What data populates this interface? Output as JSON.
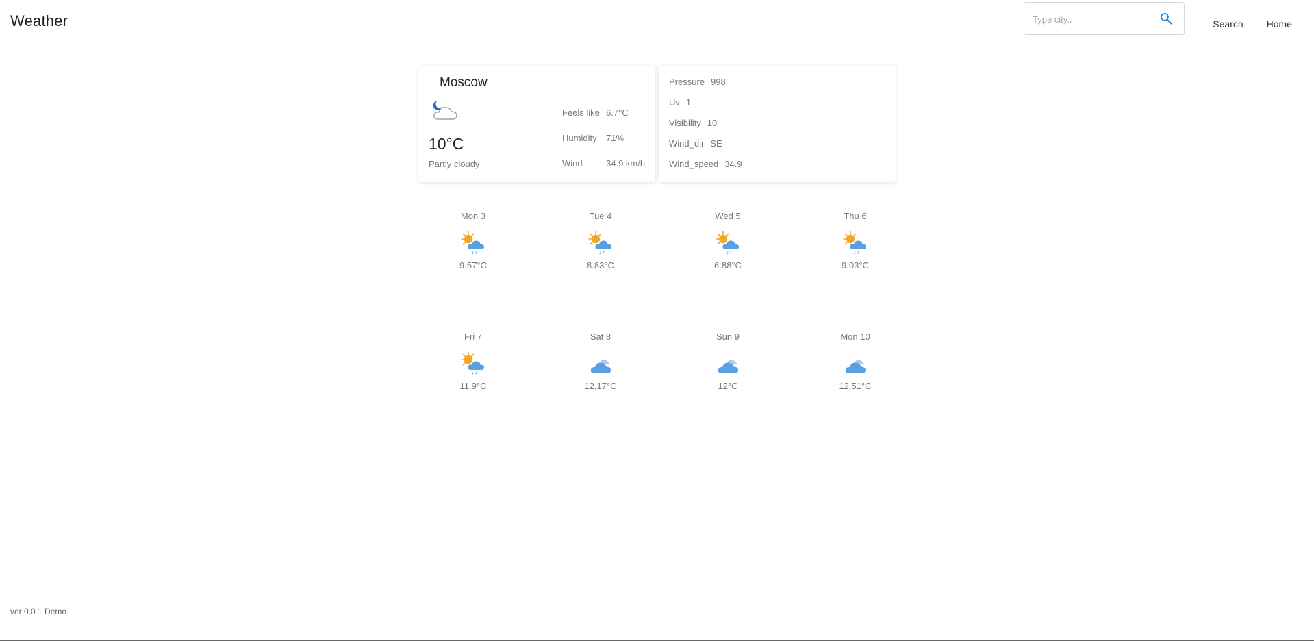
{
  "header": {
    "brand": "Weather",
    "search_placeholder": "Type city..",
    "search_value": "",
    "nav": [
      "Search",
      "Home"
    ]
  },
  "current": {
    "city": "Moscow",
    "icon": "moon-cloud-icon",
    "temp": "10°C",
    "condition": "Partly cloudy",
    "metrics": [
      {
        "label": "Feels like",
        "value": "6.7°C"
      },
      {
        "label": "Humidity",
        "value": "71%"
      },
      {
        "label": "Wind",
        "value": "34.9 km/h"
      }
    ]
  },
  "details": [
    {
      "label": "Pressure",
      "value": "998"
    },
    {
      "label": "Uv",
      "value": "1"
    },
    {
      "label": "Visibility",
      "value": "10"
    },
    {
      "label": "Wind_dir",
      "value": "SE"
    },
    {
      "label": "Wind_speed",
      "value": "34.9"
    }
  ],
  "forecast": [
    {
      "day": "Mon 3",
      "temp": "9.57°C",
      "icon": "sun-cloud-rain-icon"
    },
    {
      "day": "Tue 4",
      "temp": "8.83°C",
      "icon": "sun-cloud-rain-icon"
    },
    {
      "day": "Wed 5",
      "temp": "6.88°C",
      "icon": "sun-cloud-rain-icon"
    },
    {
      "day": "Thu 6",
      "temp": "9.03°C",
      "icon": "sun-cloud-rain-icon"
    },
    {
      "day": "Fri 7",
      "temp": "11.9°C",
      "icon": "sun-cloud-rain-icon"
    },
    {
      "day": "Sat 8",
      "temp": "12.17°C",
      "icon": "cloudy-icon"
    },
    {
      "day": "Sun 9",
      "temp": "12°C",
      "icon": "cloudy-icon"
    },
    {
      "day": "Mon 10",
      "temp": "12.51°C",
      "icon": "cloudy-icon"
    }
  ],
  "footer": {
    "version": "ver 0.0.1 Demo"
  },
  "colors": {
    "sun": "#f5a623",
    "cloud_blue": "#5b9fe3",
    "accent": "#1e88e5"
  }
}
